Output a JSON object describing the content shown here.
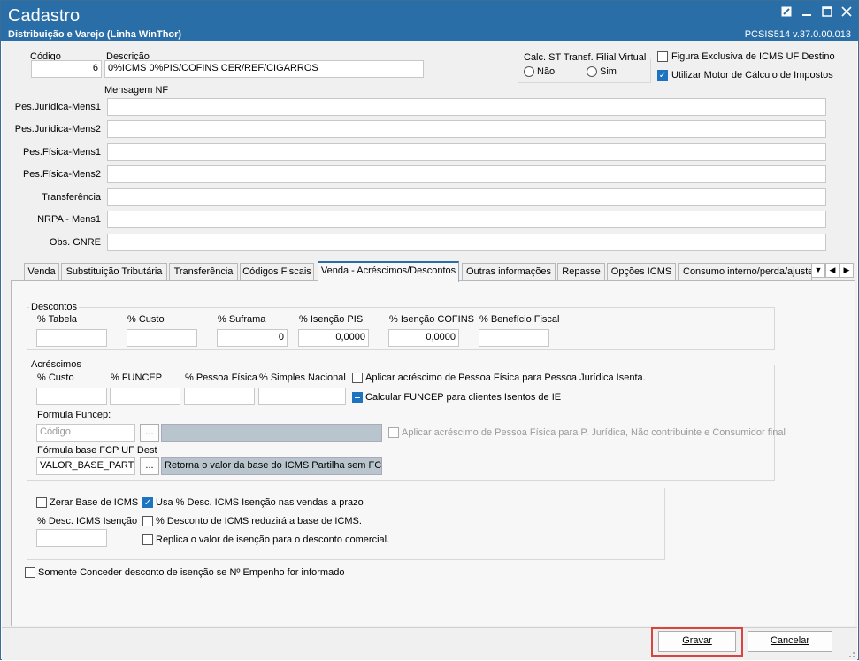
{
  "window": {
    "title": "Cadastro",
    "subtitle": "Distribuição e Varejo (Linha WinThor)",
    "version": "PCSIS514  v.37.0.00.013"
  },
  "header": {
    "codigo_label": "Código",
    "codigo_value": "6",
    "descricao_label": "Descrição",
    "descricao_value": "0%ICMS 0%PIS/COFINS  CER/REF/CIGARROS",
    "calc_st_label": "Calc. ST Transf. Filial Virtual",
    "nao_label": "Não",
    "sim_label": "Sim",
    "figura_label": "Figura Exclusiva de ICMS UF Destino",
    "utilizar_label": "Utilizar Motor de Cálculo de Impostos",
    "mensagem_label": "Mensagem NF"
  },
  "messages": [
    {
      "label": "Pes.Jurídica-Mens1",
      "value": ""
    },
    {
      "label": "Pes.Jurídica-Mens2",
      "value": ""
    },
    {
      "label": "Pes.Física-Mens1",
      "value": ""
    },
    {
      "label": "Pes.Física-Mens2",
      "value": ""
    },
    {
      "label": "Transferência",
      "value": ""
    },
    {
      "label": "NRPA - Mens1",
      "value": ""
    },
    {
      "label": "Obs. GNRE",
      "value": ""
    }
  ],
  "tabs": [
    "Venda",
    "Substituição Tributária",
    "Transferência",
    "Códigos Fiscais",
    "Venda - Acréscimos/Descontos",
    "Outras informações",
    "Repasse",
    "Opções ICMS",
    "Consumo interno/perda/ajuste"
  ],
  "descontos": {
    "title": "Descontos",
    "tabela_label": "% Tabela",
    "tabela_value": "",
    "custo_label": "% Custo",
    "custo_value": "",
    "suframa_label": "% Suframa",
    "suframa_value": "0",
    "isencao_pis_label": "% Isenção PIS",
    "isencao_pis_value": "0,0000",
    "isencao_cofins_label": "% Isenção COFINS",
    "isencao_cofins_value": "0,0000",
    "beneficio_label": "% Benefício Fiscal",
    "beneficio_value": ""
  },
  "acrescimos": {
    "title": "Acréscimos",
    "custo_label": "% Custo",
    "funcep_label": "% FUNCEP",
    "pf_label": "% Pessoa Física",
    "simples_label": "% Simples Nacional",
    "aplicar_pf_pj_label": "Aplicar acréscimo de Pessoa Física para Pessoa Jurídica Isenta.",
    "calcular_funcep_label": "Calcular FUNCEP para clientes Isentos de IE",
    "formula_funcep_label": "Formula Funcep:",
    "formula_funcep_value": "Código",
    "aplicar_pj_nc_label": "Aplicar acréscimo de Pessoa Física para P. Jurídica, Não contribuinte e Consumidor final",
    "formula_fcp_label": "Fórmula base FCP UF Dest",
    "formula_fcp_value": "VALOR_BASE_PARTILH",
    "formula_fcp_desc": "Retorna o valor da base do ICMS Partilha sem FCP",
    "dots": "..."
  },
  "icms": {
    "zerar_label": "Zerar Base de ICMS",
    "usa_label": "Usa % Desc. ICMS Isenção nas vendas a prazo",
    "desc_label": "% Desc. ICMS Isenção",
    "desc_value": "",
    "reduzira_label": "% Desconto de ICMS reduzirá a base de ICMS.",
    "replica_label": "Replica o valor de isenção para o desconto comercial."
  },
  "somente_label": "Somente Conceder desconto de isenção se Nº Empenho for informado",
  "buttons": {
    "gravar": "Gravar",
    "cancelar": "Cancelar"
  },
  "colors": {
    "titlebar": "#2a6ea7",
    "highlight": "#d9443f",
    "check": "#1e73c0"
  }
}
